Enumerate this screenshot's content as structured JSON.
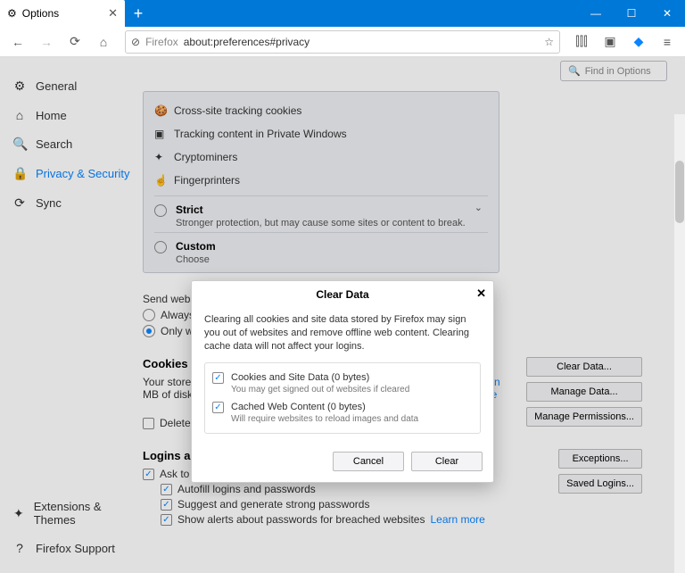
{
  "window": {
    "tab_title": "Options",
    "newtab": "+",
    "min": "—",
    "max": "☐",
    "close": "✕"
  },
  "toolbar": {
    "back": "←",
    "fwd": "→",
    "reload": "⟳",
    "home": "⌂",
    "identity": "Firefox",
    "url": "about:preferences#privacy",
    "star": "☆",
    "library": "⫿⫿⫿",
    "sidebar": "▣",
    "ext": "◆",
    "menu": "≡"
  },
  "find": {
    "icon": "🔍",
    "placeholder": "Find in Options"
  },
  "sidebar": {
    "items": [
      {
        "icon": "⚙",
        "label": "General"
      },
      {
        "icon": "⌂",
        "label": "Home"
      },
      {
        "icon": "🔍",
        "label": "Search"
      },
      {
        "icon": "🔒",
        "label": "Privacy & Security"
      },
      {
        "icon": "⟳",
        "label": "Sync"
      }
    ],
    "bottom": [
      {
        "icon": "✦",
        "label": "Extensions & Themes"
      },
      {
        "icon": "?",
        "label": "Firefox Support"
      }
    ]
  },
  "tracking": {
    "rows": [
      {
        "icon": "🍪",
        "label": "Cross-site tracking cookies"
      },
      {
        "icon": "▣",
        "label": "Tracking content in Private Windows"
      },
      {
        "icon": "✦",
        "label": "Cryptominers"
      },
      {
        "icon": "☝",
        "label": "Fingerprinters"
      }
    ],
    "strict": {
      "title": "Strict",
      "sub": "Stronger protection, but may cause some sites or content to break."
    },
    "custom": {
      "title": "Custom",
      "sub": "Choose"
    }
  },
  "dnt": {
    "heading": "Send websit",
    "opt1": "Always",
    "opt2": "Only whe"
  },
  "cookies": {
    "heading": "Cookies and",
    "desc1": "Your stored cookies, site data, and cache are currently using 70.9 MB of disk space.  ",
    "learn": "Learn more",
    "delete": "Delete cookies and site data when Firefox is closed",
    "btn_clear": "Clear Data...",
    "btn_manage": "Manage Data...",
    "btn_perm": "Manage Permissions..."
  },
  "logins": {
    "heading": "Logins and Passwords",
    "ask": "Ask to save logins and passwords for websites",
    "autofill": "Autofill logins and passwords",
    "suggest": "Suggest and generate strong passwords",
    "alerts": "Show alerts about passwords for breached websites  ",
    "learn": "Learn more",
    "btn_exc": "Exceptions...",
    "btn_saved": "Saved Logins..."
  },
  "dialog": {
    "title": "Clear Data",
    "close": "✕",
    "desc": "Clearing all cookies and site data stored by Firefox may sign you out of websites and remove offline web content. Clearing cache data will not affect your logins.",
    "item1": {
      "label": "Cookies and Site Data (0 bytes)",
      "sub": "You may get signed out of websites if cleared"
    },
    "item2": {
      "label": "Cached Web Content (0 bytes)",
      "sub": "Will require websites to reload images and data"
    },
    "cancel": "Cancel",
    "clear": "Clear"
  }
}
